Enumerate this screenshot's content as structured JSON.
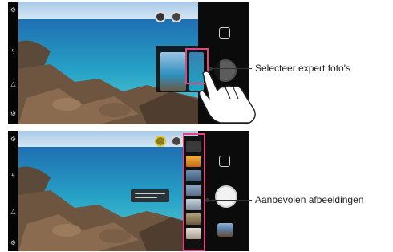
{
  "callouts": {
    "expert_photos": "Selecteer expert foto's",
    "recommended_images": "Aanbevolen afbeeldingen"
  },
  "icons": {
    "settings": "gear-icon",
    "flash": "flash-icon",
    "timer": "timer-icon",
    "switch_camera": "switch-camera-icon",
    "shutter": "shutter-button",
    "gallery": "gallery-thumbnail"
  },
  "colors": {
    "highlight": "#e2457a",
    "ai_badge": "#e0c330"
  }
}
